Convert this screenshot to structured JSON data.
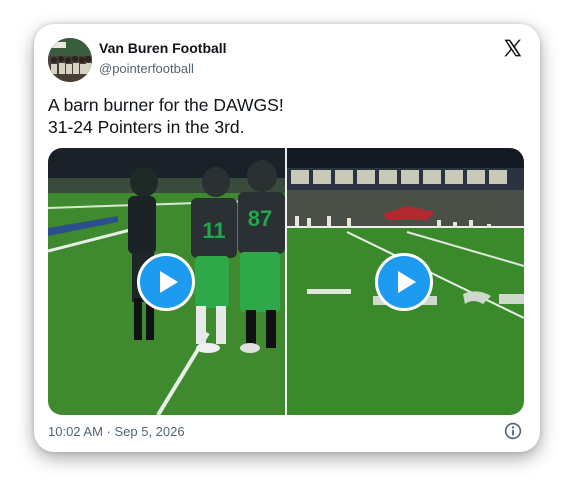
{
  "author": {
    "name": "Van Buren Football",
    "handle": "@pointerfootball"
  },
  "tweet": {
    "line1": "A barn burner for the DAWGS!",
    "line2": "31-24 Pointers in the 3rd.",
    "timestamp": "10:02 AM · Sep 5, 2026"
  },
  "media": {
    "videos": [
      {
        "jersey_numbers": [
          "11",
          "87"
        ]
      },
      {}
    ]
  },
  "colors": {
    "play_button": "#1d9bf0",
    "text_primary": "#0f1419",
    "text_secondary": "#536471",
    "jersey_green": "#22a84a"
  },
  "icons": {
    "brand": "x-logo-icon",
    "play": "play-icon",
    "info": "info-icon"
  }
}
